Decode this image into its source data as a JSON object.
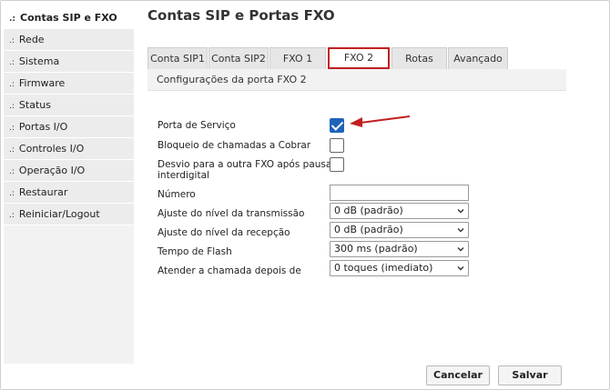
{
  "sidebar": {
    "bullet": ".:",
    "items": [
      {
        "label": "Contas SIP e FXO"
      },
      {
        "label": "Rede"
      },
      {
        "label": "Sistema"
      },
      {
        "label": "Firmware"
      },
      {
        "label": "Status"
      },
      {
        "label": "Portas I/O"
      },
      {
        "label": "Controles I/O"
      },
      {
        "label": "Operação I/O"
      },
      {
        "label": "Restaurar"
      },
      {
        "label": "Reiniciar/Logout"
      }
    ]
  },
  "header": {
    "title": "Contas SIP e Portas FXO"
  },
  "tabs": [
    {
      "label": "Conta SIP1"
    },
    {
      "label": "Conta SIP2"
    },
    {
      "label": "FXO 1"
    },
    {
      "label": "FXO 2"
    },
    {
      "label": "Rotas"
    },
    {
      "label": "Avançado"
    }
  ],
  "section": {
    "title": "Configurações da porta FXO 2"
  },
  "form": {
    "porta_servico": {
      "label": "Porta de Serviço",
      "checked": true
    },
    "bloqueio": {
      "label": "Bloqueio de chamadas a Cobrar",
      "checked": false
    },
    "desvio": {
      "label_line1": "Desvio para a outra FXO após pausa",
      "label_line2": "interdigital",
      "checked": false
    },
    "numero": {
      "label": "Número",
      "value": ""
    },
    "transmissao": {
      "label": "Ajuste do nível da transmissão",
      "value": "0 dB (padrão)"
    },
    "recepcao": {
      "label": "Ajuste do nível da recepção",
      "value": "0 dB (padrão)"
    },
    "flash": {
      "label": "Tempo de Flash",
      "value": "300 ms (padrão)"
    },
    "atender": {
      "label": "Atender a chamada depois de",
      "value": "0 toques (imediato)"
    }
  },
  "buttons": {
    "cancel": "Cancelar",
    "save": "Salvar"
  },
  "colors": {
    "active_tab_border": "#c21f1f",
    "checkbox_checked": "#1f63b8",
    "annotation_arrow": "#c21f1f"
  }
}
